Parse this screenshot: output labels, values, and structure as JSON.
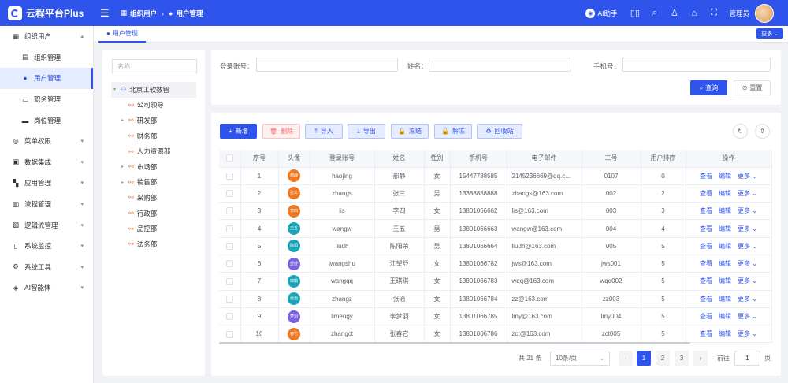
{
  "app": {
    "title": "云程平台Plus"
  },
  "header": {
    "breadcrumb": [
      "组织用户",
      "用户管理"
    ],
    "ai_label": "AI助手",
    "user": "管理员"
  },
  "tabs": {
    "active": "用户管理",
    "more": "更多"
  },
  "sidebar": {
    "items": [
      {
        "label": "组织用户",
        "icon": "org-icon",
        "arrow": "▴"
      },
      {
        "label": "组织管理",
        "icon": "building-icon",
        "sub": true
      },
      {
        "label": "用户管理",
        "icon": "user-icon",
        "sub": true,
        "active": true
      },
      {
        "label": "职务管理",
        "icon": "id-card-icon",
        "sub": true
      },
      {
        "label": "岗位管理",
        "icon": "briefcase-icon",
        "sub": true
      },
      {
        "label": "菜单权限",
        "icon": "menu-icon",
        "arrow": "▾"
      },
      {
        "label": "数据集成",
        "icon": "database-icon",
        "arrow": "▾"
      },
      {
        "label": "应用管理",
        "icon": "apps-icon",
        "arrow": "▾"
      },
      {
        "label": "流程管理",
        "icon": "flow-icon",
        "arrow": "▾"
      },
      {
        "label": "逻辑流管理",
        "icon": "logic-icon",
        "arrow": "▾"
      },
      {
        "label": "系统监控",
        "icon": "monitor-icon",
        "arrow": "▾"
      },
      {
        "label": "系统工具",
        "icon": "tool-icon",
        "arrow": "▾"
      },
      {
        "label": "AI智能体",
        "icon": "robot-icon",
        "arrow": "▾"
      }
    ]
  },
  "tree": {
    "placeholder": "名称",
    "nodes": [
      {
        "label": "北京工软数智",
        "level": 0,
        "caret": "▾",
        "root": true
      },
      {
        "label": "公司领导",
        "level": 1,
        "caret": ""
      },
      {
        "label": "研发部",
        "level": 1,
        "caret": "▸"
      },
      {
        "label": "财务部",
        "level": 1,
        "caret": ""
      },
      {
        "label": "人力资源部",
        "level": 1,
        "caret": ""
      },
      {
        "label": "市场部",
        "level": 1,
        "caret": "▸"
      },
      {
        "label": "销售部",
        "level": 1,
        "caret": "▸"
      },
      {
        "label": "采购部",
        "level": 1,
        "caret": ""
      },
      {
        "label": "行政部",
        "level": 1,
        "caret": ""
      },
      {
        "label": "品控部",
        "level": 1,
        "caret": ""
      },
      {
        "label": "法务部",
        "level": 1,
        "caret": ""
      }
    ]
  },
  "search": {
    "account_label": "登录账号：",
    "name_label": "姓名：",
    "phone_label": "手机号：",
    "query_btn": "查询",
    "reset_btn": "重置"
  },
  "toolbar": {
    "add": "新增",
    "delete": "删除",
    "import": "导入",
    "export": "导出",
    "freeze": "冻结",
    "unfreeze": "解冻",
    "recycle": "回收站"
  },
  "table": {
    "headers": [
      "",
      "序号",
      "头像",
      "登录账号",
      "姓名",
      "性别",
      "手机号",
      "电子邮件",
      "工号",
      "用户排序",
      "操作"
    ],
    "actions": {
      "view": "查看",
      "edit": "编辑",
      "more": "更多"
    },
    "rows": [
      {
        "no": "1",
        "avatar": "郝静",
        "color": "#f07820",
        "account": "haojing",
        "name": "郝静",
        "gender": "女",
        "phone": "15447788585",
        "email": "2145236669@qq.c...",
        "code": "0107",
        "order": "0"
      },
      {
        "no": "2",
        "avatar": "张三",
        "color": "#f07820",
        "account": "zhangs",
        "name": "张三",
        "gender": "男",
        "phone": "13388888888",
        "email": "zhangs@163.com",
        "code": "002",
        "order": "2"
      },
      {
        "no": "3",
        "avatar": "李四",
        "color": "#f07820",
        "account": "lis",
        "name": "李四",
        "gender": "女",
        "phone": "13801066662",
        "email": "lis@163.com",
        "code": "003",
        "order": "3"
      },
      {
        "no": "4",
        "avatar": "王五",
        "color": "#1aa6b8",
        "account": "wangw",
        "name": "王五",
        "gender": "男",
        "phone": "13801066663",
        "email": "wangw@163.com",
        "code": "004",
        "order": "4"
      },
      {
        "no": "5",
        "avatar": "陈阳",
        "color": "#1aa6b8",
        "account": "liudh",
        "name": "陈阳荣",
        "gender": "男",
        "phone": "13801066664",
        "email": "liudh@163.com",
        "code": "005",
        "order": "5"
      },
      {
        "no": "6",
        "avatar": "望舒",
        "color": "#7b61e0",
        "account": "jwangshu",
        "name": "江望舒",
        "gender": "女",
        "phone": "13801066782",
        "email": "jws@163.com",
        "code": "jws001",
        "order": "5"
      },
      {
        "no": "7",
        "avatar": "琪琪",
        "color": "#1aa6b8",
        "account": "wangqq",
        "name": "王琪琪",
        "gender": "女",
        "phone": "13801066783",
        "email": "wqq@163.com",
        "code": "wqq002",
        "order": "5"
      },
      {
        "no": "8",
        "avatar": "张治",
        "color": "#1aa6b8",
        "account": "zhangz",
        "name": "张治",
        "gender": "女",
        "phone": "13801066784",
        "email": "zz@163.com",
        "code": "zz003",
        "order": "5"
      },
      {
        "no": "9",
        "avatar": "梦羽",
        "color": "#7b61e0",
        "account": "limengy",
        "name": "李梦羽",
        "gender": "女",
        "phone": "13801066785",
        "email": "lmy@163.com",
        "code": "lmy004",
        "order": "5"
      },
      {
        "no": "10",
        "avatar": "春它",
        "color": "#f07820",
        "account": "zhangct",
        "name": "张春它",
        "gender": "女",
        "phone": "13801066786",
        "email": "zct@163.com",
        "code": "zct005",
        "order": "5"
      }
    ]
  },
  "pagination": {
    "total": "共 21 条",
    "page_size": "10条/页",
    "pages": [
      "1",
      "2",
      "3"
    ],
    "current": "1",
    "goto_label": "前往",
    "goto_value": "1",
    "page_unit": "页"
  },
  "colors": {
    "primary": "#2f54eb",
    "danger": "#f56c6c"
  }
}
